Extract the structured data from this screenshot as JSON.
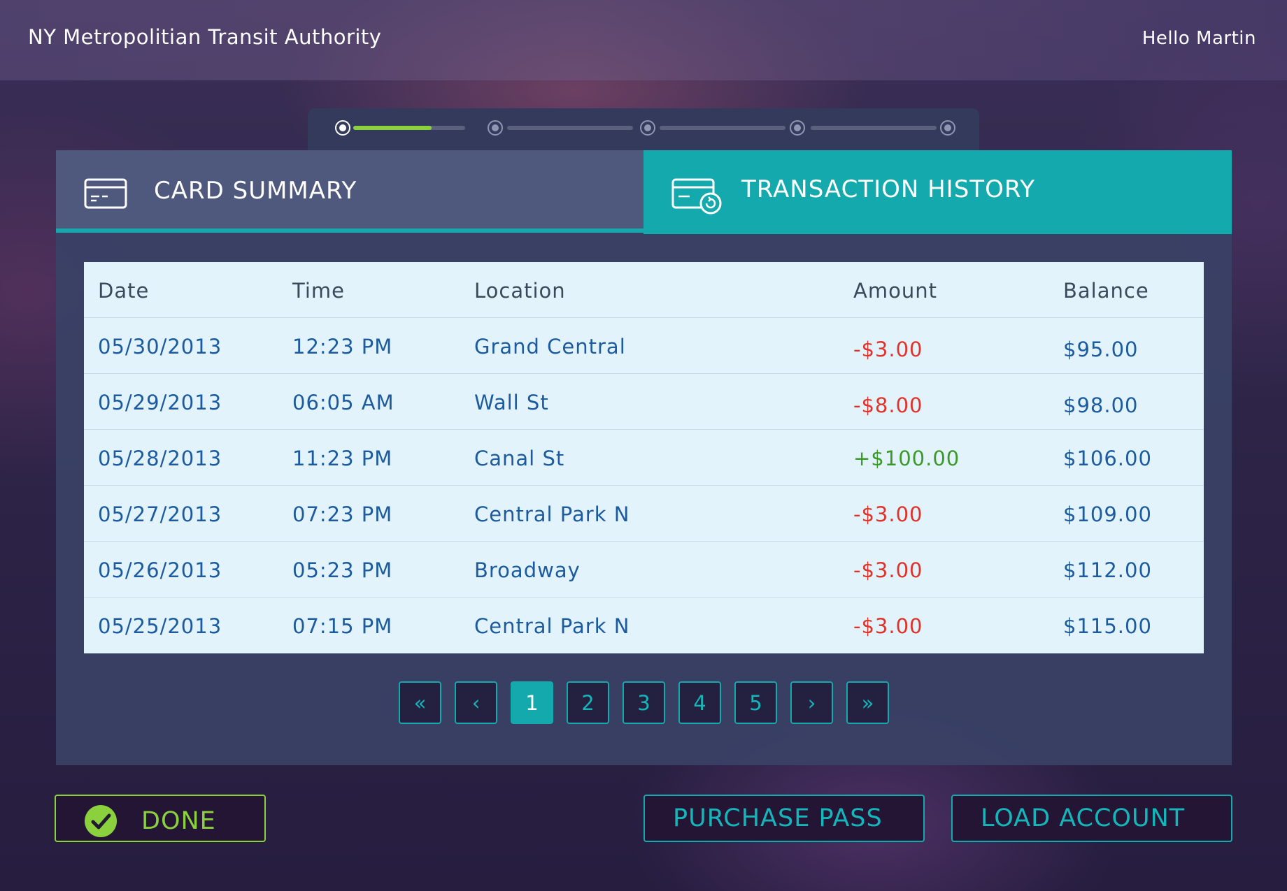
{
  "header": {
    "title": "NY Metropolitian Transit Authority",
    "greeting": "Hello Martin"
  },
  "stepper": {
    "steps": 5,
    "current_step": 1,
    "progress_first_segment": 0.7
  },
  "tabs": {
    "card_summary": {
      "label": "CARD SUMMARY",
      "icon": "credit-card-icon",
      "active": false
    },
    "transaction_history": {
      "label": "TRANSACTION HISTORY",
      "icon": "card-refresh-icon",
      "active": true
    }
  },
  "table": {
    "columns": [
      "Date",
      "Time",
      "Location",
      "Amount",
      "Balance"
    ],
    "rows": [
      {
        "date": "05/30/2013",
        "time": "12:23 PM",
        "location": "Grand Central",
        "amount": "-$3.00",
        "balance": "$95.00",
        "type": "debit"
      },
      {
        "date": "05/29/2013",
        "time": "06:05 AM",
        "location": "Wall St",
        "amount": "-$8.00",
        "balance": "$98.00",
        "type": "debit"
      },
      {
        "date": "05/28/2013",
        "time": "11:23 PM",
        "location": "Canal St",
        "amount": "+$100.00",
        "balance": "$106.00",
        "type": "credit"
      },
      {
        "date": "05/27/2013",
        "time": "07:23 PM",
        "location": "Central Park N",
        "amount": "-$3.00",
        "balance": "$109.00",
        "type": "debit"
      },
      {
        "date": "05/26/2013",
        "time": "05:23 PM",
        "location": "Broadway",
        "amount": "-$3.00",
        "balance": "$112.00",
        "type": "debit"
      },
      {
        "date": "05/25/2013",
        "time": "07:15 PM",
        "location": "Central Park N",
        "amount": "-$3.00",
        "balance": "$115.00",
        "type": "debit"
      }
    ]
  },
  "pagination": {
    "first": "«",
    "prev": "‹",
    "pages": [
      "1",
      "2",
      "3",
      "4",
      "5"
    ],
    "current": "1",
    "next": "›",
    "last": "»"
  },
  "actions": {
    "done": "DONE",
    "purchase_pass": "PURCHASE PASS",
    "load_account": "LOAD ACCOUNT"
  },
  "colors": {
    "accent_teal": "#14a9ad",
    "accent_green": "#8bd13e",
    "debit_red": "#e2332a",
    "credit_green": "#3c9a2a"
  }
}
